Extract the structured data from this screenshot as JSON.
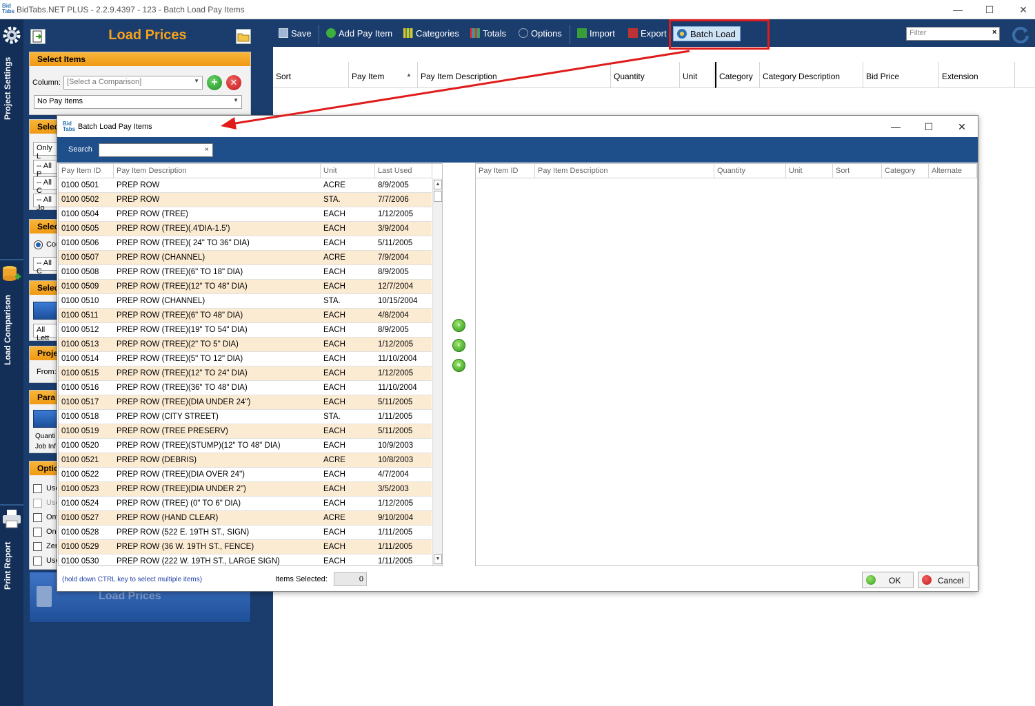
{
  "window": {
    "title": "BidTabs.NET PLUS - 2.2.9.4397 - 123 - Batch Load Pay Items",
    "logo_text": "Bid Tabs"
  },
  "rail": {
    "project_settings": "Project Settings",
    "load_comparison": "Load Comparison",
    "print_report": "Print Report"
  },
  "sidebar": {
    "title": "Load Prices",
    "select_items": {
      "heading": "Select Items",
      "column_label": "Column:",
      "column_placeholder": "[Select a Comparison]",
      "pay_items_value": "No Pay Items"
    },
    "section2": {
      "heading": "Selec",
      "combo1": "Only L",
      "combo2": "-- All P",
      "combo3": "-- All C",
      "combo4": "-- All Jo"
    },
    "section3": {
      "heading": "Selec",
      "radio_label": "Cou",
      "combo": "-- All C"
    },
    "section4": {
      "heading": "Selec",
      "combo": "All Lett"
    },
    "section5": {
      "heading": "Proje",
      "from_label": "From:"
    },
    "section6": {
      "heading": "Para",
      "line1": "Quanti",
      "line2": "Job Inf"
    },
    "options": {
      "heading": "Optio",
      "items": [
        "Use",
        "Use",
        "Om",
        "Onl",
        "Zer",
        "Use"
      ]
    },
    "load_prices_button": "Load Prices"
  },
  "toolbar": {
    "save": "Save",
    "add_pay_item": "Add Pay Item",
    "categories": "Categories",
    "totals": "Totals",
    "options": "Options",
    "import": "Import",
    "export": "Export",
    "batch_load": "Batch Load",
    "filter_placeholder": "Filter",
    "filter_clear": "×"
  },
  "main_grid": {
    "columns": [
      "Sort",
      "Pay Item",
      "Pay Item Description",
      "Quantity",
      "Unit",
      "Category",
      "Category Description",
      "Bid Price",
      "Extension"
    ]
  },
  "dialog": {
    "title": "Batch Load Pay Items",
    "search_label": "Search",
    "search_value": "",
    "search_clear": "×",
    "left_columns": [
      "Pay Item ID",
      "Pay Item Description",
      "Unit",
      "Last Used"
    ],
    "right_columns": [
      "Pay Item ID",
      "Pay Item Description",
      "Quantity",
      "Unit",
      "Sort",
      "Category",
      "Alternate"
    ],
    "rows": [
      [
        "0100 0501",
        "PREP ROW",
        "ACRE",
        "8/9/2005"
      ],
      [
        "0100 0502",
        "PREP ROW",
        "STA.",
        "7/7/2006"
      ],
      [
        "0100 0504",
        "PREP ROW (TREE)",
        "EACH",
        "1/12/2005"
      ],
      [
        "0100 0505",
        "PREP ROW (TREE)(.4'DIA-1.5')",
        "EACH",
        "3/9/2004"
      ],
      [
        "0100 0506",
        "PREP ROW (TREE)( 24\" TO 36\" DIA)",
        "EACH",
        "5/11/2005"
      ],
      [
        "0100 0507",
        "PREP ROW (CHANNEL)",
        "ACRE",
        "7/9/2004"
      ],
      [
        "0100 0508",
        "PREP ROW (TREE)(6\" TO 18\" DIA)",
        "EACH",
        "8/9/2005"
      ],
      [
        "0100 0509",
        "PREP ROW (TREE)(12\" TO 48\" DIA)",
        "EACH",
        "12/7/2004"
      ],
      [
        "0100 0510",
        "PREP ROW (CHANNEL)",
        "STA.",
        "10/15/2004"
      ],
      [
        "0100 0511",
        "PREP ROW (TREE)(6\" TO 48\" DIA)",
        "EACH",
        "4/8/2004"
      ],
      [
        "0100 0512",
        "PREP ROW (TREE)(19\" TO 54\" DIA)",
        "EACH",
        "8/9/2005"
      ],
      [
        "0100 0513",
        "PREP ROW (TREE)(2\" TO 5\" DIA)",
        "EACH",
        "1/12/2005"
      ],
      [
        "0100 0514",
        "PREP ROW (TREE)(5\" TO 12\" DIA)",
        "EACH",
        "11/10/2004"
      ],
      [
        "0100 0515",
        "PREP ROW (TREE)(12\" TO 24\" DIA)",
        "EACH",
        "1/12/2005"
      ],
      [
        "0100 0516",
        "PREP ROW (TREE)(36\" TO 48\" DIA)",
        "EACH",
        "11/10/2004"
      ],
      [
        "0100 0517",
        "PREP ROW (TREE)(DIA UNDER 24\")",
        "EACH",
        "5/11/2005"
      ],
      [
        "0100 0518",
        "PREP ROW (CITY STREET)",
        "STA.",
        "1/11/2005"
      ],
      [
        "0100 0519",
        "PREP ROW (TREE PRESERV)",
        "EACH",
        "5/11/2005"
      ],
      [
        "0100 0520",
        "PREP ROW (TREE)(STUMP)(12\" TO 48\" DIA)",
        "EACH",
        "10/9/2003"
      ],
      [
        "0100 0521",
        "PREP ROW (DEBRIS)",
        "ACRE",
        "10/8/2003"
      ],
      [
        "0100 0522",
        "PREP ROW (TREE)(DIA OVER 24\")",
        "EACH",
        "4/7/2004"
      ],
      [
        "0100 0523",
        "PREP ROW (TREE)(DIA UNDER 2\")",
        "EACH",
        "3/5/2003"
      ],
      [
        "0100 0524",
        "PREP ROW (TREE) (0\" TO 6\" DIA)",
        "EACH",
        "1/12/2005"
      ],
      [
        "0100 0527",
        "PREP ROW (HAND CLEAR)",
        "ACRE",
        "9/10/2004"
      ],
      [
        "0100 0528",
        "PREP ROW (522 E. 19TH ST., SIGN)",
        "EACH",
        "1/11/2005"
      ],
      [
        "0100 0529",
        "PREP ROW (36 W. 19TH ST., FENCE)",
        "EACH",
        "1/11/2005"
      ],
      [
        "0100 0530",
        "PREP ROW (222 W. 19TH ST., LARGE SIGN)",
        "EACH",
        "1/11/2005"
      ]
    ],
    "hint": "(hold down CTRL key to select multiple items)",
    "items_selected_label": "Items Selected:",
    "items_selected_value": "0",
    "ok_label": "OK",
    "cancel_label": "Cancel"
  },
  "colors": {
    "navy": "#1b3d6e",
    "orange": "#f7a21b",
    "highlight": "#e01b1b",
    "row_alt": "#fcebd3"
  }
}
